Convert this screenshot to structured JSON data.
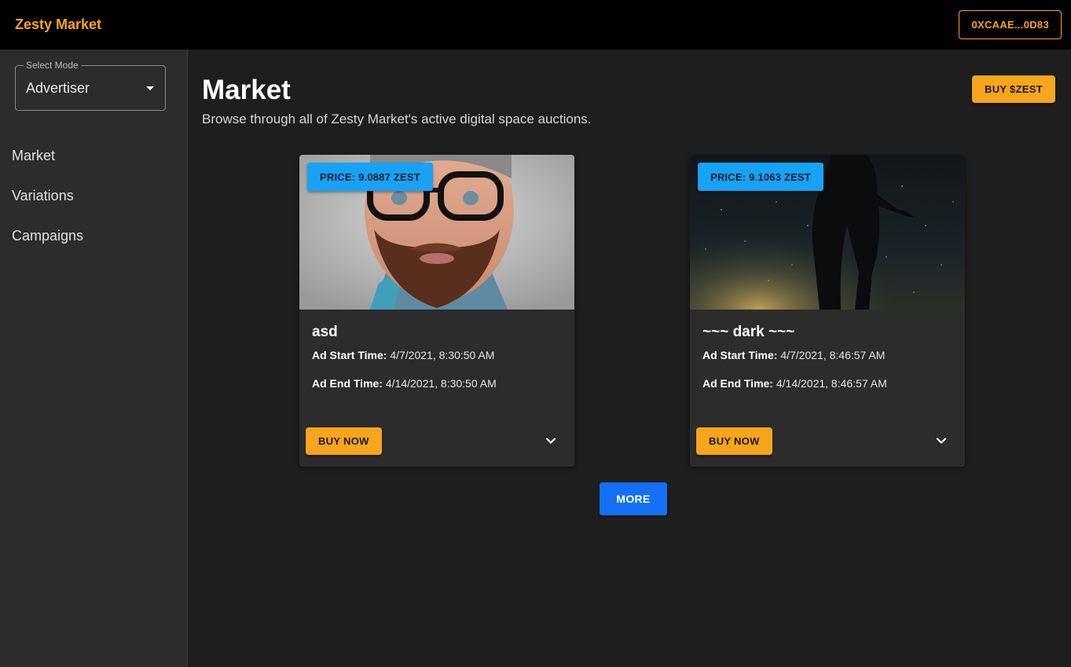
{
  "header": {
    "brand": "Zesty Market",
    "wallet_label": "0XCAAE...0D83",
    "accent_color": "#f7a51c"
  },
  "sidebar": {
    "mode_select": {
      "legend": "Select Mode",
      "value": "Advertiser"
    },
    "items": [
      {
        "label": "Market"
      },
      {
        "label": "Variations"
      },
      {
        "label": "Campaigns"
      }
    ]
  },
  "main": {
    "title": "Market",
    "subtitle": "Browse through all of Zesty Market's active digital space auctions.",
    "buy_zest_label": "BUY $ZEST",
    "cards": [
      {
        "price": "PRICE: 9.0887 ZEST",
        "title": "asd",
        "start_label": "Ad Start Time:",
        "start_value": "4/7/2021, 8:30:50 AM",
        "end_label": "Ad End Time:",
        "end_value": "4/14/2021, 8:30:50 AM",
        "buy_label": "BUY NOW"
      },
      {
        "price": "PRICE: 9.1063 ZEST",
        "title": "~~~ dark ~~~",
        "start_label": "Ad Start Time:",
        "start_value": "4/7/2021, 8:46:57 AM",
        "end_label": "Ad End Time:",
        "end_value": "4/14/2021, 8:46:57 AM",
        "buy_label": "BUY NOW"
      }
    ],
    "more_label": "MORE"
  }
}
